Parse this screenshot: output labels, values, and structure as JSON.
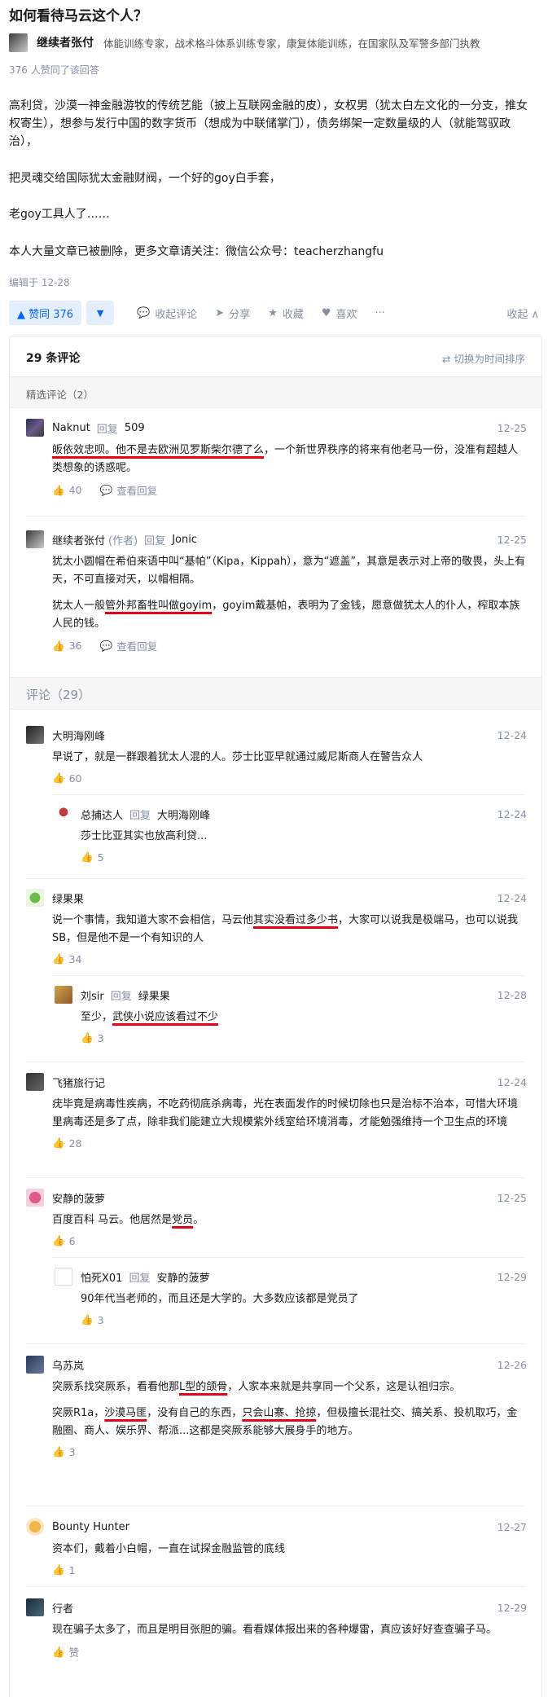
{
  "question": {
    "title": "如何看待马云这个人？"
  },
  "answer": {
    "author": {
      "name": "继续者张付",
      "bio": "体能训练专家，战术格斗体系训练专家，康复体能训练，在国家队及军警多部门执教"
    },
    "upvote_summary": "376 人赞同了该回答",
    "paragraphs": [
      "高利贷，沙漠一神金融游牧的传统艺能（披上互联网金融的皮），女权男（犹太白左文化的一分支，推女权寄生），想参与发行中国的数字货币（想成为中联储掌门），债务绑架一定数量级的人（就能驾驭政治），",
      "把灵魂交给国际犹太金融财阀，一个好的goy白手套，",
      "老goy工具人了……",
      "本人大量文章已被删除，更多文章请关注：微信公众号：teacherzhangfu"
    ],
    "edited": "编辑于 12-28"
  },
  "actions": {
    "upvote": "▲ 赞同 376",
    "downvote": "▼",
    "comments": "收起评论",
    "share": "分享",
    "favorite": "收藏",
    "like": "喜欢",
    "more": "···",
    "collapse": "收起 ∧"
  },
  "comments": {
    "count_label": "29 条评论",
    "switch_label": "⇄ 切换为时间排序",
    "featured_label": "精选评论（2）",
    "all_label": "评论（29）",
    "reply_word": "回复",
    "view_replies": "查看回复",
    "featured": [
      {
        "name": "Naknut",
        "tag": "",
        "target": "509",
        "date": "12-25",
        "p1a": "",
        "p1u": "皈依效忠呗。他不是去欧洲见罗斯柴尔德了么",
        "p1b": "，一个新世界秩序的将来有他老马一份，没准有超越人类想象的诱惑呢。",
        "likes": "40"
      },
      {
        "name": "继续者张付",
        "tag": "(作者)",
        "target": "Jonic",
        "date": "12-25",
        "p1": "犹太小圆帽在希伯来语中叫“基帕”（Kipa，Kippah），意为“遮盖”，其意是表示对上帝的敬畏，头上有天，不可直接对天，以帽相隔。",
        "p2a": "犹太人一般",
        "p2u": "管外邦畜牲叫做goyim",
        "p2b": "，goyim戴基帕，表明为了金钱，愿意做犹太人的仆人，榨取本族人民的钱。",
        "likes": "36"
      }
    ],
    "all": [
      {
        "name": "大明海刚峰",
        "date": "12-24",
        "text": "早说了，就是一群跟着犹太人混的人。莎士比亚早就通过威尼斯商人在警告众人",
        "likes": "60"
      },
      {
        "name": "总捕达人",
        "target": "大明海刚峰",
        "date": "12-24",
        "text": "莎士比亚其实也放高利贷...",
        "likes": "5"
      },
      {
        "name": "绿果果",
        "date": "12-24",
        "ta": "说一个事情，我知道大家不会相信，马云他",
        "tu": "其实没看过多少书",
        "tb": "，大家可以说我是极端马，也可以说我SB，但是他不是一个有知识的人",
        "likes": "34"
      },
      {
        "name": "刘sir",
        "target": "绿果果",
        "date": "12-28",
        "ta": "至少，",
        "tu": "武侠小说应该看过不少",
        "tb": "",
        "likes": "3"
      },
      {
        "name": "飞猪旅行记",
        "date": "12-24",
        "text": "疣毕竟是病毒性疾病，不吃药彻底杀病毒，光在表面发作的时候切除也只是治标不治本，可惜大环境里病毒还是多了点，除非我们能建立大规模紫外线室给环境消毒，才能勉强维持一个卫生点的环境",
        "likes": "28"
      },
      {
        "name": "安静的菠萝",
        "date": "12-25",
        "ta": "百度百科 马云。他居然是",
        "tu": "党员",
        "tb": "。",
        "likes": "6"
      },
      {
        "name": "怕死X01",
        "target": "安静的菠萝",
        "date": "12-29",
        "text": "90年代当老师的，而且还是大学的。大多数应该都是党员了",
        "likes": "3"
      },
      {
        "name": "乌苏岚",
        "date": "12-26",
        "p1a": "突厥系找突厥系，看看他那",
        "p1u": "L型的颌骨",
        "p1b": "，人家本来就是共享同一个父系，这是认祖归宗。",
        "p2a": "突厥R1a，",
        "p2u": "沙漠马匪",
        "p2m": "，没有自己的东西，",
        "p2u2": "只会山寨、抢掠",
        "p2b": "，但极擅长混社交、搞关系、投机取巧，金融圈、商人、娱乐界、帮派...这都是突厥系能够大展身手的地方。",
        "likes": "3"
      },
      {
        "name": "Bounty Hunter",
        "date": "12-27",
        "text": "资本们，戴着小白帽，一直在试探金融监管的底线",
        "likes": "1"
      },
      {
        "name": "行者",
        "date": "12-29",
        "text": "现在骗子太多了，而且是明目张胆的骗。看看媒体报出来的各种爆雷，真应该好好查查骗子马。",
        "likes": "赞"
      }
    ]
  },
  "colors": {
    "accent": "#0066ff",
    "muted": "#8590a6",
    "underline": "#e60012"
  }
}
